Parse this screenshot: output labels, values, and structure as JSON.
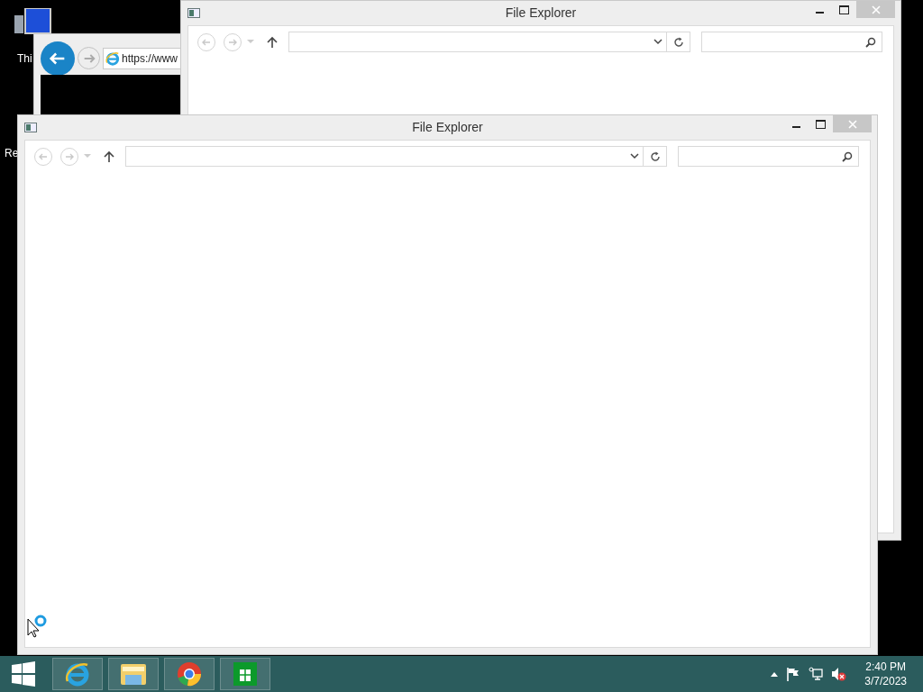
{
  "desktop": {
    "icons": [
      {
        "kind": "computer",
        "label": "Thi"
      },
      {
        "kind": "bin",
        "label": "Re"
      }
    ]
  },
  "windows": [
    {
      "kind": "browser",
      "address": "https://www"
    },
    {
      "kind": "explorer",
      "title": "File Explorer"
    },
    {
      "kind": "explorer",
      "title": "File Explorer"
    }
  ],
  "taskbar": {
    "pinned": [
      {
        "kind": "ie"
      },
      {
        "kind": "folder"
      },
      {
        "kind": "chrome"
      },
      {
        "kind": "store"
      }
    ],
    "clock": {
      "time": "2:40 PM",
      "date": "3/7/2023"
    }
  }
}
